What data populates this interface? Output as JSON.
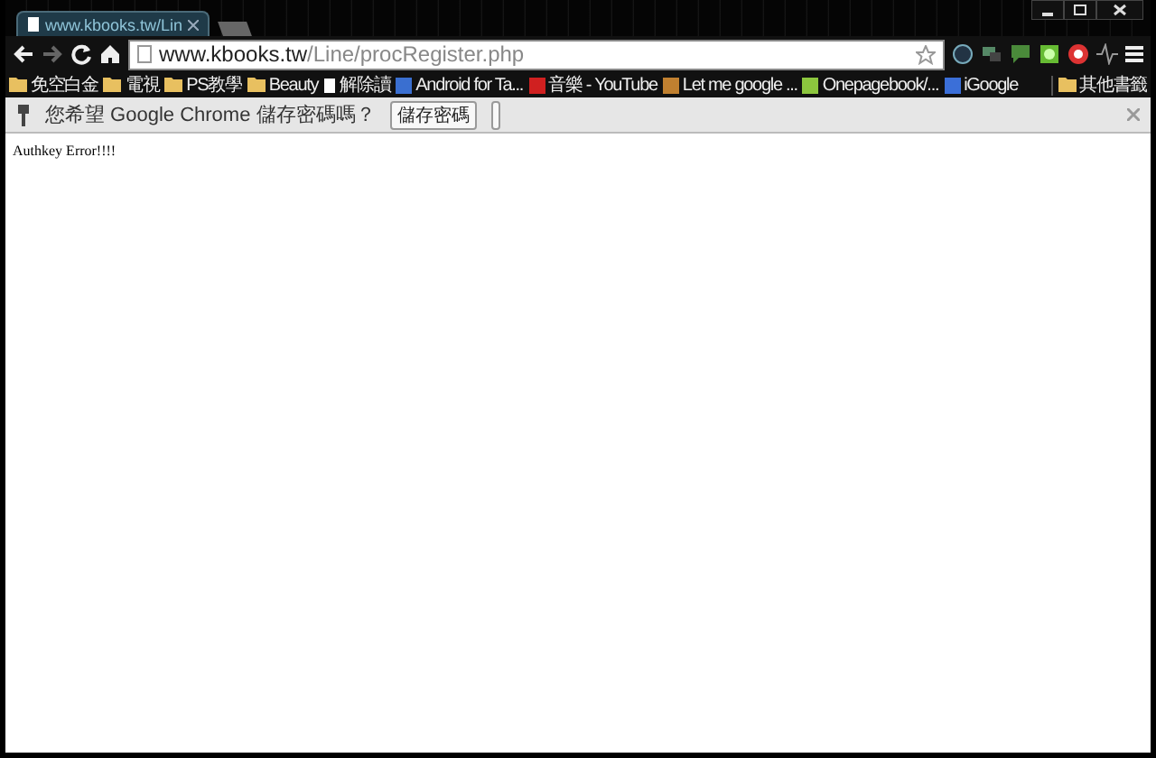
{
  "tabs": [
    {
      "title": "www.kbooks.tw/Lin",
      "selected": true
    }
  ],
  "address_bar": {
    "host": "www.kbooks.tw",
    "path": "/Line/procRegister.php"
  },
  "bookmarks": [
    {
      "label": "免空白金",
      "kind": "folder"
    },
    {
      "label": "電視",
      "kind": "folder"
    },
    {
      "label": "PS教學",
      "kind": "folder"
    },
    {
      "label": "Beauty",
      "kind": "folder"
    },
    {
      "label": "解除讀",
      "kind": "page"
    },
    {
      "label": "Android for Ta...",
      "kind": "site",
      "color": "#3a6fd0"
    },
    {
      "label": "音樂 - YouTube",
      "kind": "site",
      "color": "#d02020"
    },
    {
      "label": "Let me google ...",
      "kind": "site",
      "color": "#c08030"
    },
    {
      "label": "Onepagebook/...",
      "kind": "site",
      "color": "#8cc63e"
    },
    {
      "label": "iGoogle",
      "kind": "site",
      "color": "#3b6fd8"
    }
  ],
  "other_bookmarks": "其他書籤",
  "infobar": {
    "message": "您希望 Google Chrome 儲存密碼嗎？",
    "buttons": [
      "儲存密碼"
    ]
  },
  "page": {
    "text": "Authkey Error!!!!"
  }
}
